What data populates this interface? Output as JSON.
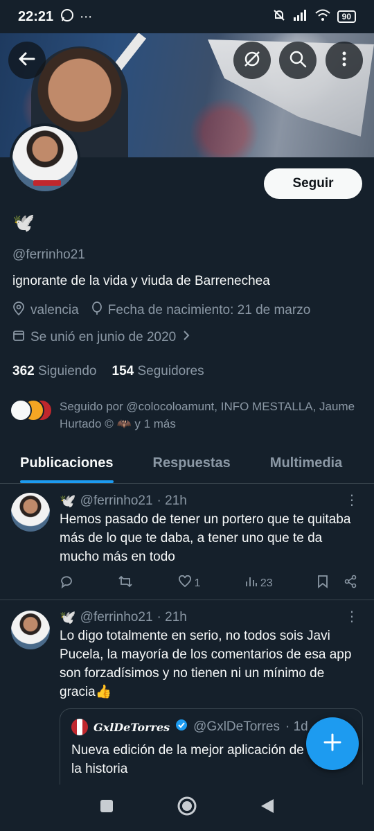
{
  "status_bar": {
    "time": "22:21",
    "battery": "90"
  },
  "profile": {
    "emoji": "🕊️",
    "handle": "@ferrinho21",
    "bio": "ignorante de la vida y viuda de Barrenechea",
    "location": "valencia",
    "birthday": "Fecha de nacimiento: 21 de marzo",
    "joined": "Se unió en junio de 2020",
    "following_count": "362",
    "following_label": "Siguiendo",
    "followers_count": "154",
    "followers_label": "Seguidores",
    "follow_button": "Seguir",
    "followed_by": "Seguido por @colocoloamunt, INFO MESTALLA, Jaume Hurtado © 🦇 y 1 más"
  },
  "tabs": [
    "Publicaciones",
    "Respuestas",
    "Multimedia"
  ],
  "tweets": [
    {
      "emoji": "🕊️",
      "handle": "@ferrinho21",
      "time": "· 21h",
      "text": "Hemos pasado de tener un portero que te quitaba más de lo que te daba, a tener uno que te da mucho más en todo",
      "likes": "1",
      "views": "23"
    },
    {
      "emoji": "🕊️",
      "handle": "@ferrinho21",
      "time": "· 21h",
      "text": "Lo digo totalmente en serio, no todos sois Javi Pucela, la mayoría de los comentarios de esa app son forzadísimos y no tienen ni un mínimo de gracia👍",
      "quote": {
        "name": "GxlDeTorres",
        "handle": "@GxlDeTorres",
        "time": "· 1d",
        "text": "Nueva edición de la mejor aplicación de la historia"
      }
    }
  ],
  "colors": {
    "background": "#15202b",
    "accent": "#1d9bf0",
    "muted": "#8b98a5"
  }
}
